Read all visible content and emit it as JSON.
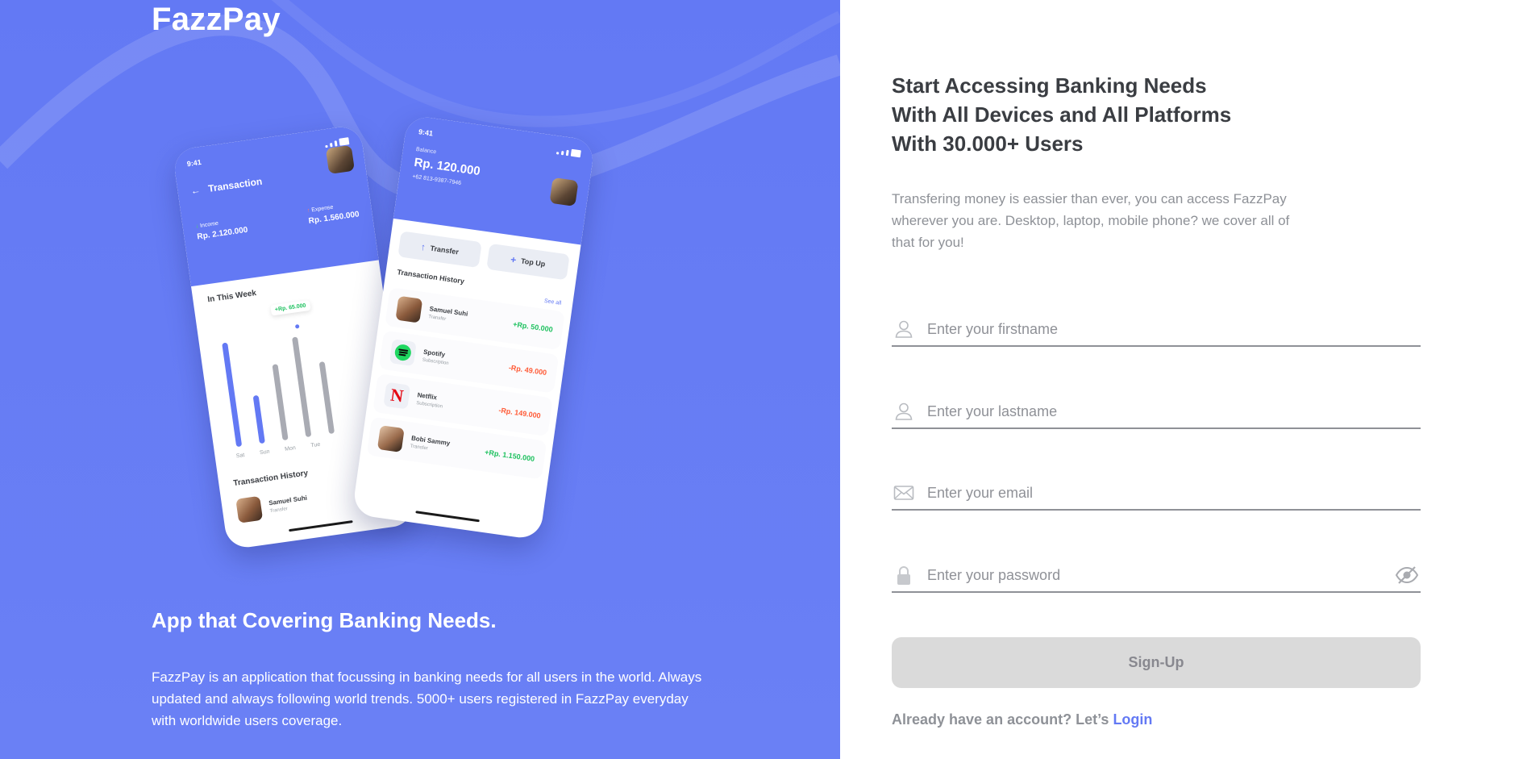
{
  "brand": "FazzPay",
  "colors": {
    "primary": "#6379f4",
    "text_dark": "#3a3d42",
    "text_muted": "#8e9197",
    "button_disabled": "#dadada",
    "income_green": "#1ec15f",
    "expense_red": "#ff5b37"
  },
  "hero": {
    "heading": "App that Covering Banking Needs.",
    "description": "FazzPay is an application that focussing in banking needs for all users in the world. Always updated and always following world trends. 5000+ users registered in FazzPay everyday with worldwide users coverage."
  },
  "phone_transaction": {
    "time": "9:41",
    "title": "Transaction",
    "income_label": "Income",
    "income_value": "Rp. 2.120.000",
    "expense_label": "Expense",
    "expense_value": "Rp. 1.560.000",
    "week_label": "In This Week",
    "tooltip": "+Rp. 65.000",
    "days": [
      "Sat",
      "Sun",
      "Mon",
      "Tue"
    ],
    "history_label": "Transaction History",
    "row_name": "Samuel Suhi",
    "row_type": "Transfer"
  },
  "phone_home": {
    "time": "9:41",
    "balance_label": "Balance",
    "balance": "Rp. 120.000",
    "phone_number": "+62 813-9387-7946",
    "transfer_label": "Transfer",
    "topup_label": "Top Up",
    "history_label": "Transaction History",
    "see_all": "See all",
    "transactions": [
      {
        "name": "Samuel Suhi",
        "type": "Transfer",
        "amount": "+Rp. 50.000",
        "icon": "avatar"
      },
      {
        "name": "Spotify",
        "type": "Subscription",
        "amount": "-Rp. 49.000",
        "icon": "spotify-logo"
      },
      {
        "name": "Netflix",
        "type": "Subscription",
        "amount": "-Rp. 149.000",
        "icon": "netflix-logo"
      },
      {
        "name": "Bobi Sammy",
        "type": "Transfer",
        "amount": "+Rp. 1.150.000",
        "icon": "avatar"
      }
    ]
  },
  "form": {
    "heading_lines": [
      "Start Accessing Banking Needs",
      "With All Devices and All Platforms",
      "With 30.000+ Users"
    ],
    "description": "Transfering money is eassier than ever, you can access FazzPay wherever you are. Desktop, laptop, mobile phone? we cover all of that for you!",
    "firstname_placeholder": "Enter your firstname",
    "lastname_placeholder": "Enter your lastname",
    "email_placeholder": "Enter your email",
    "password_placeholder": "Enter your password",
    "signup_label": "Sign-Up",
    "login_prompt": "Already have an account? Let’s",
    "login_link": "Login"
  }
}
